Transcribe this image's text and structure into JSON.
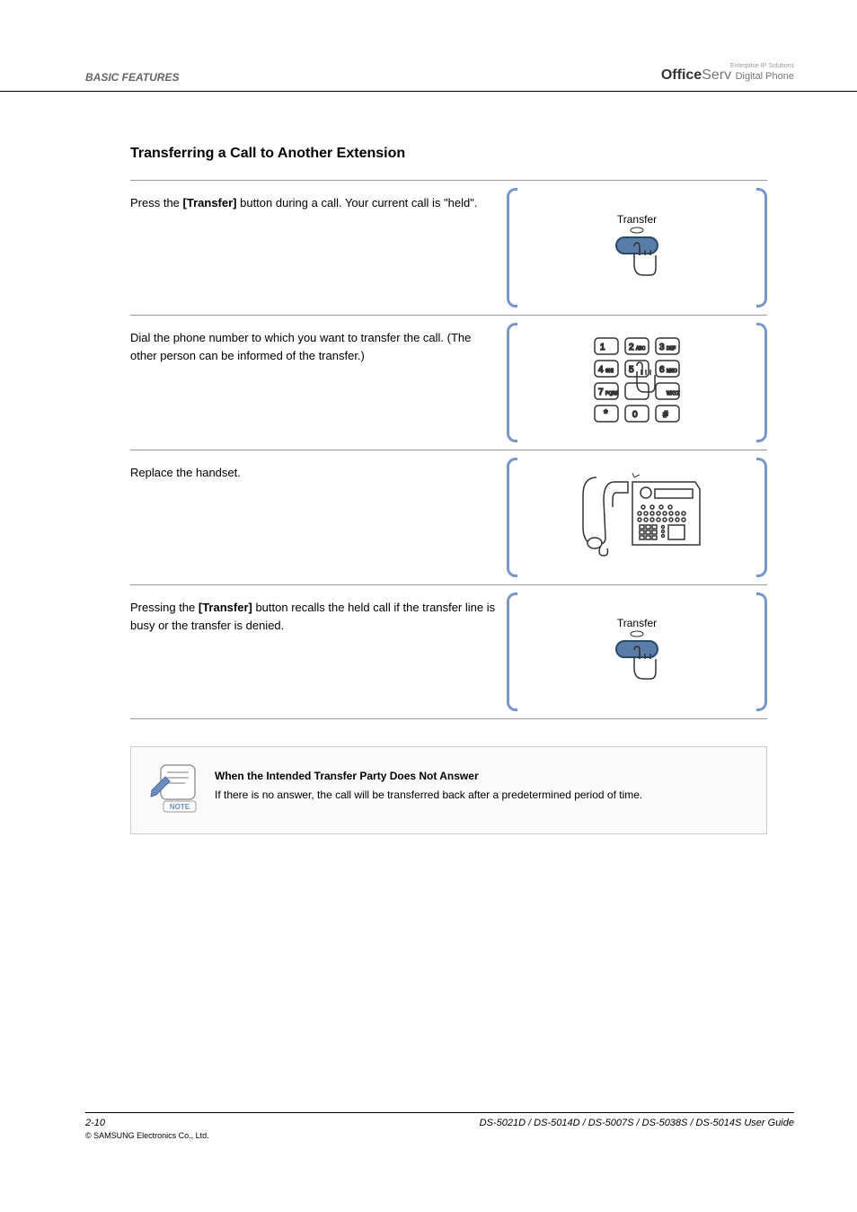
{
  "header": {
    "left": "BASIC FEATURES",
    "tagline": "Enterprise IP Solutions",
    "logo_bold": "Office",
    "logo_light": "Serv",
    "logo_sub": "Digital Phone"
  },
  "section_title": "Transferring a Call to Another Extension",
  "steps": [
    {
      "text_parts": [
        "Press the ",
        "[Transfer]",
        " button during a call. Your current call is \"held\"."
      ],
      "illustration": "transfer_button"
    },
    {
      "text_parts": [
        "Dial the phone number to which you want to transfer the call. (The other person can be informed of the transfer.)"
      ],
      "illustration": "keypad"
    },
    {
      "text_parts": [
        "Replace the handset."
      ],
      "illustration": "phone_hangup"
    },
    {
      "text_parts": [
        "Pressing the ",
        "[Transfer]",
        " button recalls the held call if the transfer line is busy or the transfer is denied."
      ],
      "illustration": "transfer_button"
    }
  ],
  "note": {
    "title": "When the Intended Transfer Party Does Not Answer",
    "body": "If there is no answer, the call will be transferred back after a predetermined period of time."
  },
  "footer": {
    "left": "2-10",
    "right": "DS-5021D / DS-5014D / DS-5007S / DS-5038S / DS-5014S User Guide",
    "copyright": "© SAMSUNG Electronics Co., Ltd."
  },
  "icons": {
    "transfer_label": "Transfer"
  }
}
